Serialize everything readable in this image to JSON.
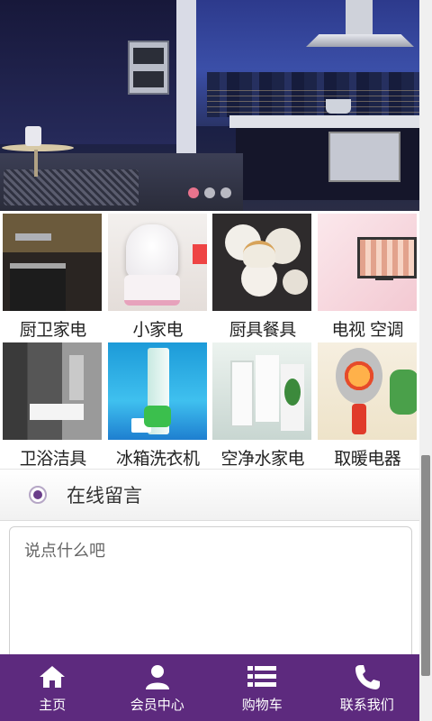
{
  "banner": {
    "slides_total": 3,
    "active_slide": 1,
    "dot_colors": {
      "active": "#e8738d",
      "inactive": "#b9b9c2"
    }
  },
  "categories": [
    {
      "label": "厨卫家电",
      "thumb": "t1"
    },
    {
      "label": "小家电",
      "thumb": "t2"
    },
    {
      "label": "厨具餐具",
      "thumb": "t3"
    },
    {
      "label": "电视 空调",
      "thumb": "t4"
    },
    {
      "label": "卫浴洁具",
      "thumb": "t5"
    },
    {
      "label": "冰箱洗衣机",
      "thumb": "t6"
    },
    {
      "label": "空净水家电",
      "thumb": "t7"
    },
    {
      "label": "取暖电器",
      "thumb": "t8"
    }
  ],
  "message": {
    "title": "在线留言",
    "placeholder": "说点什么吧"
  },
  "bottom_nav": {
    "color": "#5d2a7e",
    "items": [
      {
        "label": "主页",
        "icon": "home-icon"
      },
      {
        "label": "会员中心",
        "icon": "user-icon"
      },
      {
        "label": "购物车",
        "icon": "list-icon"
      },
      {
        "label": "联系我们",
        "icon": "phone-icon"
      }
    ]
  }
}
